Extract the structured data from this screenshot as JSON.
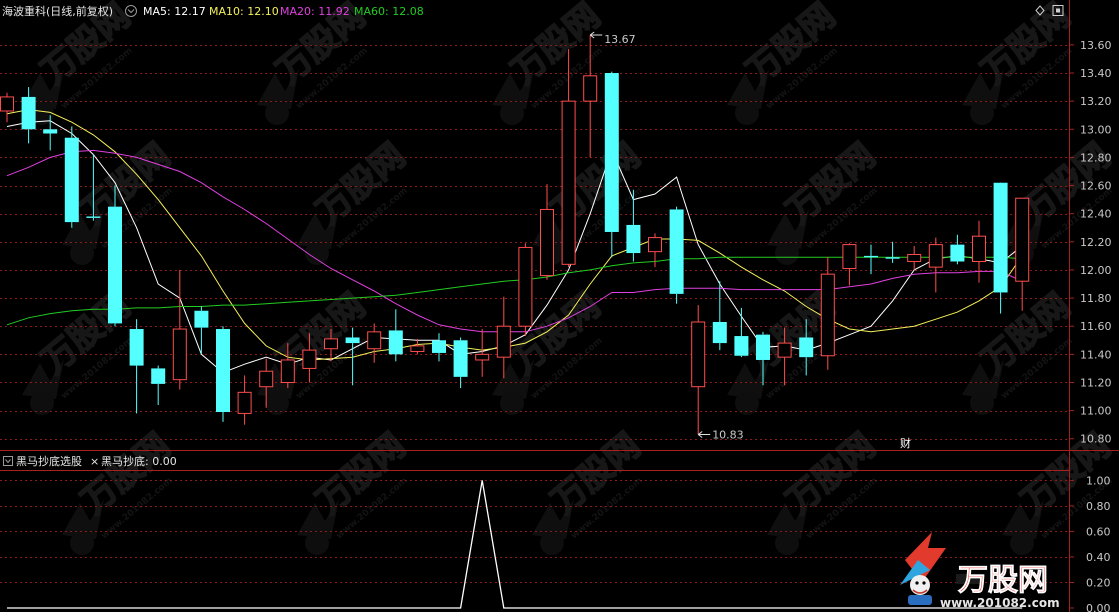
{
  "header": {
    "stock_title": "海波重科(日线,前复权)",
    "ma5_label": "MA5: 12.17",
    "ma10_label": "MA10: 12.10",
    "ma20_label": "MA20: 11.92",
    "ma60_label": "MA60: 12.08"
  },
  "indicator_header": {
    "name": "黑马抄底选股",
    "close_glyph": "×",
    "value_label": "黑马抄底: 0.00"
  },
  "annotations": {
    "high_label": "13.67",
    "low_label": "10.83",
    "cai_marker": "财"
  },
  "watermark": {
    "brand": "万股网",
    "site": "www.201082.com"
  },
  "icons": {
    "settings": "diamond-icon",
    "window": "window-toggle-icon",
    "collapse": "collapse-square-icon"
  },
  "colors": {
    "up": "#ff4d4d",
    "down": "#54ffff",
    "ma5": "#ffffff",
    "ma10": "#f5f05a",
    "ma20": "#e040e0",
    "ma60": "#22cc22",
    "grid": "#8b1a1a",
    "axis": "#aa2020"
  },
  "chart_data": [
    {
      "type": "candlestick",
      "title": "海波重科(日线,前复权)",
      "ylim": [
        10.72,
        13.72
      ],
      "y_ticks": [
        10.8,
        11.0,
        11.2,
        11.4,
        11.6,
        11.8,
        12.0,
        12.2,
        12.4,
        12.6,
        12.8,
        13.0,
        13.2,
        13.4,
        13.6
      ],
      "grid": true,
      "candles": [
        {
          "o": 13.13,
          "c": 13.23,
          "h": 13.26,
          "l": 13.05
        },
        {
          "o": 13.23,
          "c": 13.0,
          "h": 13.3,
          "l": 12.9
        },
        {
          "o": 13.0,
          "c": 12.97,
          "h": 13.1,
          "l": 12.85
        },
        {
          "o": 12.94,
          "c": 12.34,
          "h": 13.02,
          "l": 12.3
        },
        {
          "o": 12.38,
          "c": 12.37,
          "h": 12.82,
          "l": 12.35
        },
        {
          "o": 12.45,
          "c": 11.62,
          "h": 12.6,
          "l": 11.6
        },
        {
          "o": 11.58,
          "c": 11.32,
          "h": 11.65,
          "l": 10.98
        },
        {
          "o": 11.3,
          "c": 11.19,
          "h": 11.32,
          "l": 11.04
        },
        {
          "o": 11.22,
          "c": 11.58,
          "h": 12.0,
          "l": 11.15
        },
        {
          "o": 11.71,
          "c": 11.59,
          "h": 11.74,
          "l": 11.4
        },
        {
          "o": 11.58,
          "c": 10.99,
          "h": 11.6,
          "l": 10.92
        },
        {
          "o": 10.98,
          "c": 11.13,
          "h": 11.25,
          "l": 10.9
        },
        {
          "o": 11.17,
          "c": 11.28,
          "h": 11.37,
          "l": 11.02
        },
        {
          "o": 11.2,
          "c": 11.36,
          "h": 11.48,
          "l": 11.16
        },
        {
          "o": 11.3,
          "c": 11.43,
          "h": 11.55,
          "l": 11.2
        },
        {
          "o": 11.44,
          "c": 11.51,
          "h": 11.58,
          "l": 11.35
        },
        {
          "o": 11.52,
          "c": 11.48,
          "h": 11.59,
          "l": 11.18
        },
        {
          "o": 11.44,
          "c": 11.56,
          "h": 11.62,
          "l": 11.34
        },
        {
          "o": 11.57,
          "c": 11.4,
          "h": 11.72,
          "l": 11.35
        },
        {
          "o": 11.42,
          "c": 11.46,
          "h": 11.51,
          "l": 11.4
        },
        {
          "o": 11.5,
          "c": 11.41,
          "h": 11.55,
          "l": 11.35
        },
        {
          "o": 11.5,
          "c": 11.24,
          "h": 11.52,
          "l": 11.16
        },
        {
          "o": 11.36,
          "c": 11.4,
          "h": 11.58,
          "l": 11.24
        },
        {
          "o": 11.38,
          "c": 11.6,
          "h": 11.81,
          "l": 11.23
        },
        {
          "o": 11.6,
          "c": 12.16,
          "h": 12.19,
          "l": 11.53
        },
        {
          "o": 11.96,
          "c": 12.43,
          "h": 12.61,
          "l": 11.93
        },
        {
          "o": 12.04,
          "c": 13.2,
          "h": 13.57,
          "l": 12.02
        },
        {
          "o": 13.2,
          "c": 13.38,
          "h": 13.67,
          "l": 12.8
        },
        {
          "o": 13.4,
          "c": 12.27,
          "h": 13.41,
          "l": 12.09
        },
        {
          "o": 12.32,
          "c": 12.12,
          "h": 12.57,
          "l": 12.06
        },
        {
          "o": 12.13,
          "c": 12.23,
          "h": 12.26,
          "l": 12.02
        },
        {
          "o": 12.43,
          "c": 11.83,
          "h": 12.45,
          "l": 11.76
        },
        {
          "o": 11.17,
          "c": 11.63,
          "h": 11.75,
          "l": 10.83
        },
        {
          "o": 11.63,
          "c": 11.48,
          "h": 11.92,
          "l": 11.43
        },
        {
          "o": 11.53,
          "c": 11.39,
          "h": 11.73,
          "l": 11.38
        },
        {
          "o": 11.54,
          "c": 11.36,
          "h": 11.56,
          "l": 11.18
        },
        {
          "o": 11.38,
          "c": 11.48,
          "h": 11.59,
          "l": 11.18
        },
        {
          "o": 11.52,
          "c": 11.38,
          "h": 11.65,
          "l": 11.25
        },
        {
          "o": 11.39,
          "c": 11.97,
          "h": 12.09,
          "l": 11.29
        },
        {
          "o": 12.01,
          "c": 12.18,
          "h": 12.19,
          "l": 11.89
        },
        {
          "o": 12.1,
          "c": 12.09,
          "h": 12.18,
          "l": 11.97
        },
        {
          "o": 12.09,
          "c": 12.08,
          "h": 12.2,
          "l": 12.05
        },
        {
          "o": 12.06,
          "c": 12.11,
          "h": 12.17,
          "l": 12.0
        },
        {
          "o": 12.02,
          "c": 12.18,
          "h": 12.23,
          "l": 11.84
        },
        {
          "o": 12.18,
          "c": 12.06,
          "h": 12.25,
          "l": 12.04
        },
        {
          "o": 12.06,
          "c": 12.24,
          "h": 12.35,
          "l": 11.91
        },
        {
          "o": 12.62,
          "c": 11.84,
          "h": 12.61,
          "l": 11.69
        },
        {
          "o": 11.92,
          "c": 12.51,
          "h": 12.51,
          "l": 11.71
        }
      ],
      "series": [
        {
          "name": "MA5",
          "values": [
            13.02,
            13.05,
            13.06,
            12.97,
            12.82,
            12.62,
            12.3,
            11.9,
            11.8,
            11.4,
            11.27,
            11.33,
            11.38,
            11.33,
            11.38,
            11.36,
            11.44,
            11.52,
            11.51,
            11.5,
            11.5,
            11.4,
            11.42,
            11.46,
            11.54,
            11.75,
            12.0,
            12.4,
            12.85,
            12.5,
            12.54,
            12.66,
            12.18,
            11.9,
            11.67,
            11.45,
            11.46,
            11.43,
            11.48,
            11.54,
            11.6,
            11.78,
            12.0,
            12.08,
            12.1,
            12.08,
            12.05,
            12.17
          ]
        },
        {
          "name": "MA10",
          "values": [
            13.11,
            13.14,
            13.12,
            13.05,
            12.96,
            12.84,
            12.68,
            12.5,
            12.3,
            12.1,
            11.85,
            11.62,
            11.46,
            11.38,
            11.36,
            11.37,
            11.38,
            11.42,
            11.44,
            11.47,
            11.48,
            11.45,
            11.43,
            11.45,
            11.48,
            11.56,
            11.68,
            11.9,
            12.1,
            12.16,
            12.22,
            12.22,
            12.21,
            12.12,
            12.02,
            11.93,
            11.85,
            11.74,
            11.65,
            11.58,
            11.56,
            11.58,
            11.6,
            11.65,
            11.7,
            11.78,
            11.88,
            12.1
          ]
        },
        {
          "name": "MA20",
          "values": [
            12.67,
            12.73,
            12.8,
            12.84,
            12.85,
            12.83,
            12.8,
            12.75,
            12.7,
            12.62,
            12.52,
            12.43,
            12.33,
            12.22,
            12.11,
            12.01,
            11.93,
            11.85,
            11.76,
            11.68,
            11.61,
            11.58,
            11.56,
            11.56,
            11.56,
            11.6,
            11.66,
            11.74,
            11.84,
            11.84,
            11.86,
            11.87,
            11.87,
            11.87,
            11.86,
            11.86,
            11.86,
            11.86,
            11.86,
            11.88,
            11.9,
            11.94,
            11.97,
            11.98,
            11.98,
            11.99,
            11.99,
            11.92
          ]
        },
        {
          "name": "MA60",
          "values": [
            11.61,
            11.66,
            11.69,
            11.71,
            11.72,
            11.72,
            11.73,
            11.73,
            11.74,
            11.74,
            11.75,
            11.75,
            11.76,
            11.77,
            11.78,
            11.79,
            11.8,
            11.81,
            11.82,
            11.84,
            11.86,
            11.88,
            11.9,
            11.92,
            11.93,
            11.95,
            11.98,
            12.0,
            12.03,
            12.05,
            12.06,
            12.08,
            12.08,
            12.09,
            12.09,
            12.09,
            12.09,
            12.09,
            12.09,
            12.09,
            12.09,
            12.09,
            12.09,
            12.09,
            12.09,
            12.09,
            12.09,
            12.08
          ]
        }
      ]
    },
    {
      "type": "line",
      "title": "黑马抄底选股",
      "ylim": [
        0.0,
        1.05
      ],
      "y_ticks": [
        0.0,
        0.2,
        0.4,
        0.6,
        0.8,
        1.0
      ],
      "grid": true,
      "series": [
        {
          "name": "黑马抄底",
          "values": [
            0,
            0,
            0,
            0,
            0,
            0,
            0,
            0,
            0,
            0,
            0,
            0,
            0,
            0,
            0,
            0,
            0,
            0,
            0,
            0,
            0,
            0,
            1,
            0,
            0,
            0,
            0,
            0,
            0,
            0,
            0,
            0,
            0,
            0,
            0,
            0,
            0,
            0,
            0,
            0,
            0,
            0,
            0,
            0,
            0,
            0,
            0,
            0
          ]
        }
      ]
    }
  ]
}
